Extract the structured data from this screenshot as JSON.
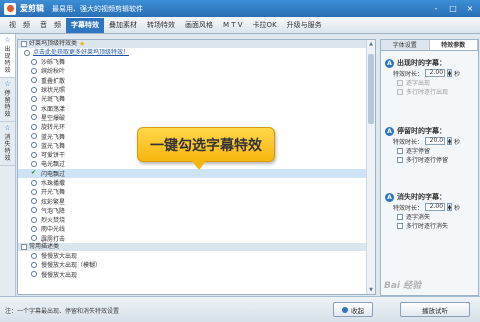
{
  "app": {
    "name": "爱剪辑",
    "slogan": "最易用、强大的视频剪辑软件"
  },
  "window_controls": [
    "-",
    "□",
    "×"
  ],
  "menu_tabs": [
    "视　频",
    "音　频",
    "字幕特效",
    "叠加素材",
    "转场特效",
    "画面风格",
    "M T V",
    "卡拉OK",
    "升级与服务"
  ],
  "active_menu_index": 2,
  "sidebar_tabs": [
    {
      "label": "出现特效",
      "active": true
    },
    {
      "label": "停留特效",
      "active": false
    },
    {
      "label": "消失特效",
      "active": false
    }
  ],
  "groups": [
    {
      "title": "好莱坞顶级特效类",
      "starred": true
    },
    {
      "title": "常用描述类",
      "starred": false
    }
  ],
  "hint_text": "点击此处获取更多好莱坞顶级特效！",
  "effects_group1": [
    "沙砾飞舞",
    "缤纷秋叶",
    "重叠扩散",
    "球状光照",
    "光斑飞舞",
    "水面荡漾",
    "星空爆破",
    "旋转光环",
    "蓝光飞舞",
    "蓝光飞舞",
    "可爱饼干",
    "电光飘过",
    "闪电飘过",
    "水珠播撒",
    "开光飞舞",
    "炫彩繁星",
    "气泡飞降",
    "烈火焚烧",
    "雨中光线",
    "霹雳打击"
  ],
  "effects_group2": [
    "慢慢放大出现",
    "慢慢放大出现（模糊）",
    "慢慢放大出现"
  ],
  "selected_effect_index": 12,
  "tooltip_text": "一键勾选字幕特效",
  "right_panel": {
    "tabs": [
      "字体设置",
      "特效参数"
    ],
    "active_tab_index": 1,
    "sections": [
      {
        "title": "出现时的字幕：",
        "duration_label": "特效时长：",
        "duration_value": "2.00",
        "unit": "秒",
        "options": [
          {
            "label": "逐字出现",
            "disabled": true
          },
          {
            "label": "多行时逐行出现",
            "disabled": true
          }
        ]
      },
      {
        "title": "停留时的字幕：",
        "duration_label": "特效时长：",
        "duration_value": "20.0",
        "unit": "秒",
        "options": [
          {
            "label": "逐字停留",
            "disabled": false
          },
          {
            "label": "多行时逐行停留",
            "disabled": false
          }
        ]
      },
      {
        "title": "消失时的字幕：",
        "duration_label": "特效时长：",
        "duration_value": "2.00",
        "unit": "秒",
        "options": [
          {
            "label": "逐字消失",
            "disabled": false
          },
          {
            "label": "多行时逐行消失",
            "disabled": false
          }
        ]
      }
    ]
  },
  "status": {
    "text": "注：一个字幕最出现、停留和消失特效设置",
    "collapse_label": "收起",
    "play_label": "播放试听"
  },
  "watermark": "Bai 经验"
}
